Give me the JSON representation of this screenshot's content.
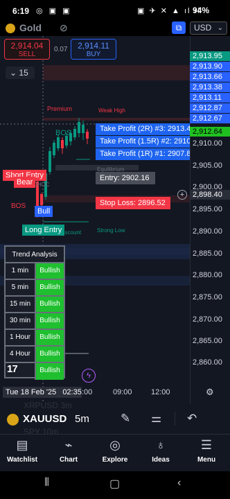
{
  "status": {
    "time": "6:19",
    "left_icons": "◎ ▣ ▣",
    "right_icons": "▣ ✈ ✕ ▲ ıl ıl",
    "battery": "94%"
  },
  "toolbar": {
    "symbol_title": "Gold",
    "currency": "USD"
  },
  "trade": {
    "sell_price": "2,914.04",
    "sell_label": "SELL",
    "spread": "0.07",
    "buy_price": "2,914.11",
    "buy_label": "BUY"
  },
  "collapse": {
    "label": "15"
  },
  "price_scale": {
    "labels": [
      "2,910.00",
      "2,905.00",
      "2,900.00",
      "2,895.00",
      "2,890.00",
      "2,885.00",
      "2,880.00",
      "2,875.00",
      "2,870.00",
      "2,865.00",
      "2,860.00"
    ],
    "top_green": "2,913.95",
    "blues": [
      "2,913.90",
      "2,913.66",
      "2,913.38",
      "2,913.11",
      "2,912.87",
      "2,912.67"
    ],
    "current_green": "2,912.64",
    "entry_marker": "2,898.40"
  },
  "levels": {
    "tp3": "Take Profit (2R) #3: 2913.4",
    "tp2": "Take Profit (1.5R) #2: 2910",
    "tp1": "Take Profit (1R) #1: 2907.8",
    "entry": "Entry: 2902.16",
    "stop": "Stop Loss: 2896.52"
  },
  "chart_labels": {
    "premium": "Premium",
    "weak_high": "Weak High",
    "equilibrium": "Equilibrium",
    "short_entry": "Short Entry",
    "bear": "Bear",
    "bull": "Bull",
    "long_entry": "Long Entry",
    "bos": "BOS",
    "strong_low": "Strong Low",
    "discount": "Discount",
    "choc": "CHOC"
  },
  "trend": {
    "title": "Trend Analysis",
    "rows": [
      {
        "tf": "1 min",
        "status": "Bullish"
      },
      {
        "tf": "5 min",
        "status": "Bullish"
      },
      {
        "tf": "15 min",
        "status": "Bullish"
      },
      {
        "tf": "30 min",
        "status": "Bullish"
      },
      {
        "tf": "1 Hour",
        "status": "Bullish"
      },
      {
        "tf": "4 Hour",
        "status": "Bullish"
      },
      {
        "tf": "",
        "status": "Bullish"
      }
    ]
  },
  "time_axis": {
    "date": "Tue 18 Feb '25",
    "time": "02:35",
    "ticks": [
      ":00",
      "09:00",
      "12:00"
    ]
  },
  "symbol_bar": {
    "symbol": "XAUUSD",
    "interval": "5m",
    "ghost_top": "XRPUSD 3m",
    "ghost_bottom": "SPY 10m"
  },
  "nav": {
    "watchlist": "Watchlist",
    "chart": "Chart",
    "explore": "Explore",
    "ideas": "Ideas",
    "menu": "Menu"
  },
  "colors": {
    "bull": "#089981",
    "bear": "#f23645",
    "accent": "#2962ff",
    "trend_green": "#1fbf2f"
  }
}
